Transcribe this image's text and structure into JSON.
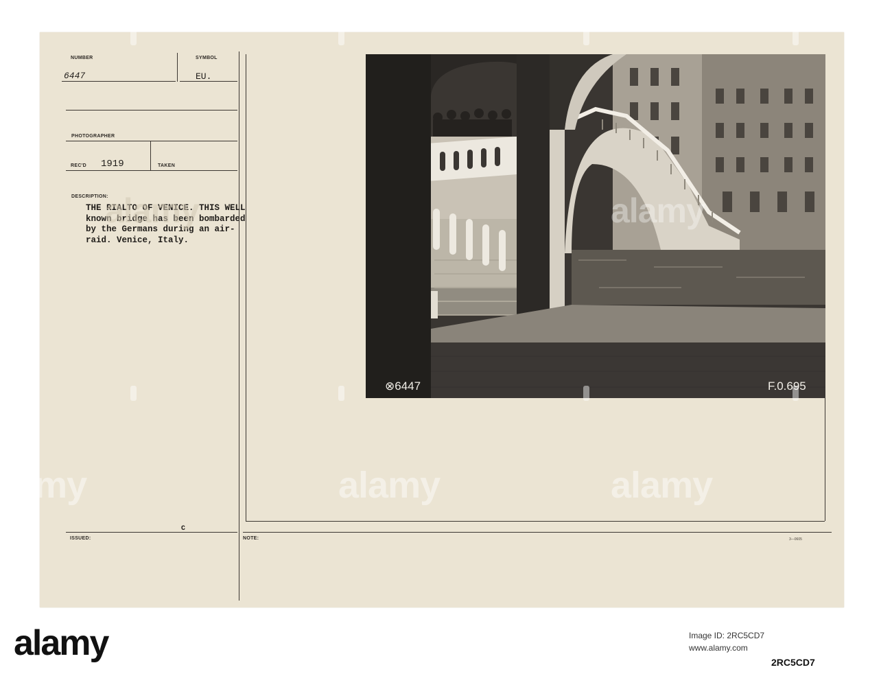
{
  "card": {
    "number_label": "NUMBER",
    "number_value": "6447",
    "symbol_label": "SYMBOL",
    "symbol_value": "EU.",
    "photographer_label": "PHOTOGRAPHER",
    "recd_label": "REC'D",
    "recd_value": "1919",
    "taken_label": "TAKEN",
    "description_label": "DESCRIPTION:",
    "description_text": "THE RIALTO OF VENICE. THIS WELL\nknown bridge has been bombarded\nby the Germans during an air-\nraid. Venice, Italy.",
    "issued_label": "ISSUED:",
    "issued_mark": "C",
    "note_label": "NOTE:",
    "form_code": "3—0605"
  },
  "photo": {
    "negative_left": "⊗6447",
    "negative_right": "F.0.695"
  },
  "watermark": {
    "text": "alamy"
  },
  "footer": {
    "logo": "alamy",
    "image_code": "2RC5CD7",
    "meta_lines": [
      "Image ID: 2RC5CD7",
      "www.alamy.com"
    ]
  }
}
